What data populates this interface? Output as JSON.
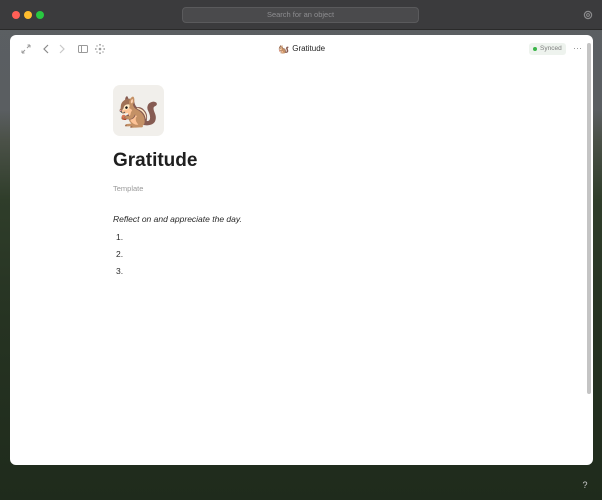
{
  "window": {
    "search_placeholder": "Search for an object"
  },
  "toolbar": {
    "page_emoji": "🐿️",
    "page_title": "Gratitude",
    "sync_status": "Synced",
    "more_label": "···",
    "icons": [
      "expand-icon",
      "back-icon",
      "forward-icon",
      "sidebar-icon",
      "graph-icon"
    ]
  },
  "page": {
    "emoji": "🐿️",
    "title": "Gratitude",
    "type": "Template",
    "description": "Reflect on and appreciate the day.",
    "list_markers": [
      "1.",
      "2.",
      "3."
    ]
  },
  "help_label": "?",
  "colors": {
    "titlebar": "#3b3b3d",
    "synced_dot": "#3bb54a",
    "traffic_red": "#ff5f57",
    "traffic_yellow": "#febc2e",
    "traffic_green": "#28c840"
  }
}
